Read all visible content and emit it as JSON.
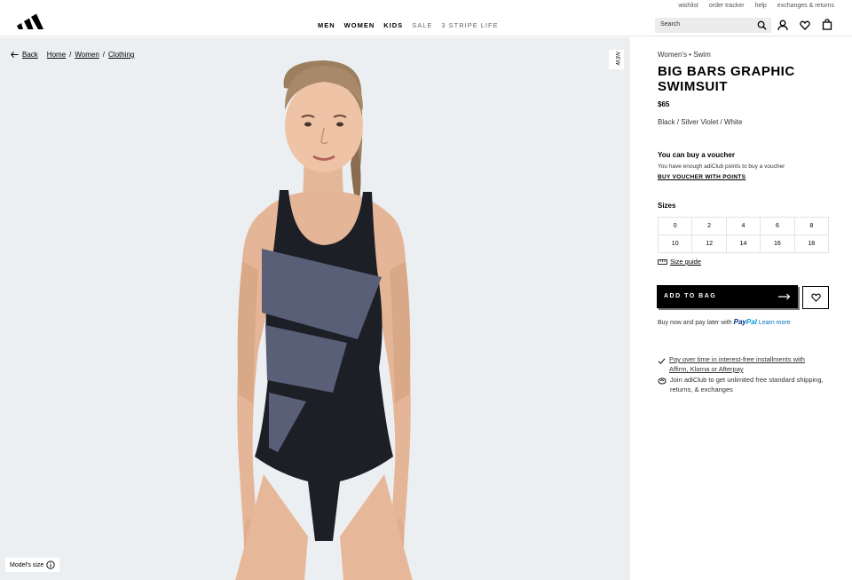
{
  "header": {
    "util_links": [
      "wishlist",
      "order tracker",
      "help",
      "exchanges & returns"
    ],
    "nav": [
      {
        "label": "MEN",
        "style": "bold"
      },
      {
        "label": "WOMEN",
        "style": "bold"
      },
      {
        "label": "KIDS",
        "style": "bold"
      },
      {
        "label": "SALE",
        "style": "light"
      },
      {
        "label": "3 STRIPE LIFE",
        "style": "light"
      }
    ],
    "search_placeholder": "Search",
    "icons": [
      "search-icon",
      "account-icon",
      "wishlist-heart-icon",
      "bag-icon"
    ]
  },
  "breadcrumb": {
    "back": "Back",
    "items": [
      "Home",
      "Women",
      "Clothing"
    ],
    "separator": "/"
  },
  "image": {
    "badge": "NEW",
    "model_size_label": "Model's size",
    "background": "#eceff1"
  },
  "product": {
    "category": "Women's • Swim",
    "title": "BIG BARS GRAPHIC SWIMSUIT",
    "price": "$65",
    "color": "Black / Silver Violet / White",
    "voucher_title": "You can buy a voucher",
    "voucher_desc": "You have enough adiClub points to buy a voucher",
    "voucher_link": "BUY VOUCHER WITH POINTS",
    "sizes_label": "Sizes",
    "sizes": [
      "0",
      "2",
      "4",
      "6",
      "8",
      "10",
      "12",
      "14",
      "16",
      "18"
    ],
    "size_guide": "Size guide",
    "add_to_bag": "ADD TO BAG",
    "paypal_prefix": "Buy now and pay later with",
    "paypal_brand_1": "Pay",
    "paypal_brand_2": "Pal",
    "paypal_more": "Learn more",
    "benefits": [
      {
        "icon": "check-icon",
        "text": "Pay over time in interest-free installments with Affirm, Klarna or Afterpay",
        "underline": true
      },
      {
        "icon": "adiclub-icon",
        "text": "Join adiClub to get unlimited free standard shipping, returns, & exchanges",
        "underline": false
      }
    ]
  },
  "colors": {
    "accent": "#000000",
    "paypal_dark": "#003087",
    "paypal_light": "#009cde",
    "link_blue": "#0070ba",
    "swimsuit": "#1c1f26",
    "graphic": "#5a5f78"
  }
}
